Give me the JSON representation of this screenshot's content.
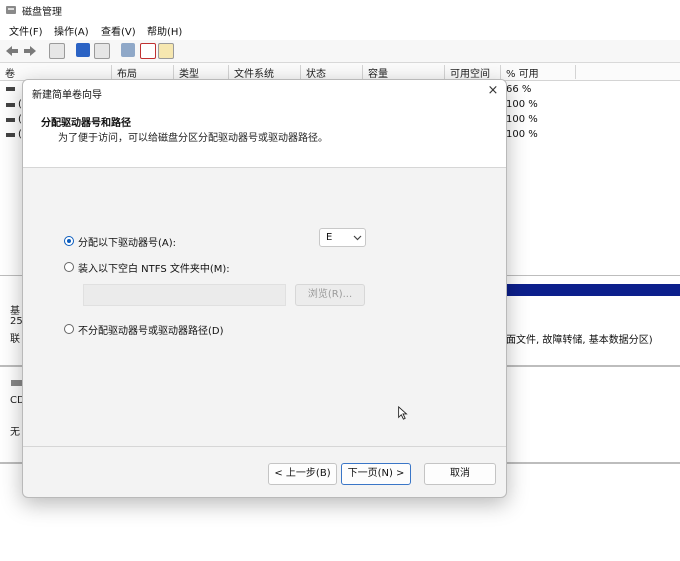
{
  "window": {
    "title": "磁盘管理"
  },
  "menu": [
    "文件(F)",
    "操作(A)",
    "查看(V)",
    "帮助(H)"
  ],
  "table": {
    "headers": [
      "卷",
      "布局",
      "类型",
      "文件系统",
      "状态",
      "容量",
      "可用空间",
      "% 可用"
    ],
    "rows": [
      {
        "prefix": "(",
        "pct_free": "66 %"
      },
      {
        "prefix": "(",
        "pct_free": "100 %"
      },
      {
        "prefix": "(",
        "pct_free": "100 %"
      },
      {
        "prefix": "(",
        "pct_free": "100 %"
      }
    ]
  },
  "disks": {
    "disk0_line1": "基",
    "disk0_line2": "25",
    "disk0_line3": "联",
    "partition_desc": "面文件, 故障转储, 基本数据分区)",
    "cd_label": "CD",
    "cd_status": "无"
  },
  "dialog": {
    "title": "新建简单卷向导",
    "close_glyph": "×",
    "heading": "分配驱动器号和路径",
    "subheading": "为了便于访问，可以给磁盘分区分配驱动器号或驱动器路径。",
    "options": {
      "assign_letter": "分配以下驱动器号(A):",
      "mount_folder": "装入以下空白 NTFS 文件夹中(M):",
      "no_assign": "不分配驱动器号或驱动器路径(D)"
    },
    "selected_option": "assign_letter",
    "drive_letter": "E",
    "path_value": "",
    "browse_label": "浏览(R)...",
    "buttons": {
      "back": "< 上一步(B)",
      "next": "下一页(N) >",
      "cancel": "取消"
    }
  },
  "colors": {
    "accent": "#0b5cbd",
    "disk_bar": "#0c1f8c"
  }
}
